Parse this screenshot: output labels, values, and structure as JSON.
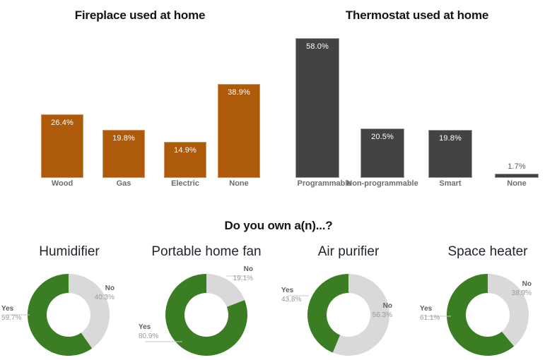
{
  "colors": {
    "orange": "#ad5a0b",
    "orange_border": "#d9935a",
    "dark_gray": "#434343",
    "dark_gray_border": "#9b9b9b",
    "green": "#3a7d22",
    "light_gray": "#d9d9d9",
    "title": "#111418",
    "category_label": "#6d6d6d",
    "value_label_muted": "#9a9a9a",
    "background": "#ffffff"
  },
  "charts": {
    "fireplace": {
      "title": "Fireplace used at home"
    },
    "thermostat": {
      "title": "Thermostat used at home"
    },
    "donuts": {
      "title": "Do you own a(n)...?"
    }
  },
  "chart_data": [
    {
      "type": "bar",
      "title": "Fireplace used at home",
      "xlabel": "",
      "ylabel": "",
      "ylim": [
        0,
        62
      ],
      "grid": false,
      "legend": "none",
      "color": "#ad5a0b",
      "categories": [
        "Wood",
        "Gas",
        "Electric",
        "None"
      ],
      "values": [
        26.4,
        19.8,
        14.9,
        38.9
      ],
      "value_labels": [
        "26.4%",
        "19.8%",
        "14.9%",
        "38.9%"
      ]
    },
    {
      "type": "bar",
      "title": "Thermostat used at home",
      "xlabel": "",
      "ylabel": "",
      "ylim": [
        0,
        62
      ],
      "grid": false,
      "legend": "none",
      "color": "#434343",
      "categories": [
        "Programmable",
        "Non-programmable",
        "Smart",
        "None"
      ],
      "values": [
        58.0,
        20.5,
        19.8,
        1.7
      ],
      "value_labels": [
        "58.0%",
        "20.5%",
        "19.8%",
        "1.7%"
      ]
    },
    {
      "type": "pie",
      "title": "Humidifier",
      "section_title": "Do you own a(n)...?",
      "labels": [
        "Yes",
        "No"
      ],
      "values": [
        59.7,
        40.3
      ],
      "value_labels": [
        "59.7%",
        "40.3%"
      ],
      "colors": [
        "#3a7d22",
        "#d9d9d9"
      ],
      "donut": true
    },
    {
      "type": "pie",
      "title": "Portable home fan",
      "section_title": "Do you own a(n)...?",
      "labels": [
        "Yes",
        "No"
      ],
      "values": [
        80.9,
        19.1
      ],
      "value_labels": [
        "80.9%",
        "19.1%"
      ],
      "colors": [
        "#3a7d22",
        "#d9d9d9"
      ],
      "donut": true
    },
    {
      "type": "pie",
      "title": "Air purifier",
      "section_title": "Do you own a(n)...?",
      "labels": [
        "Yes",
        "No"
      ],
      "values": [
        43.8,
        56.3
      ],
      "value_labels": [
        "43.8%",
        "56.3%"
      ],
      "colors": [
        "#3a7d22",
        "#d9d9d9"
      ],
      "donut": true
    },
    {
      "type": "pie",
      "title": "Space heater",
      "section_title": "Do you own a(n)...?",
      "labels": [
        "Yes",
        "No"
      ],
      "values": [
        61.1,
        38.9
      ],
      "value_labels": [
        "61.1%",
        "38.9%"
      ],
      "colors": [
        "#3a7d22",
        "#d9d9d9"
      ],
      "donut": true
    }
  ]
}
